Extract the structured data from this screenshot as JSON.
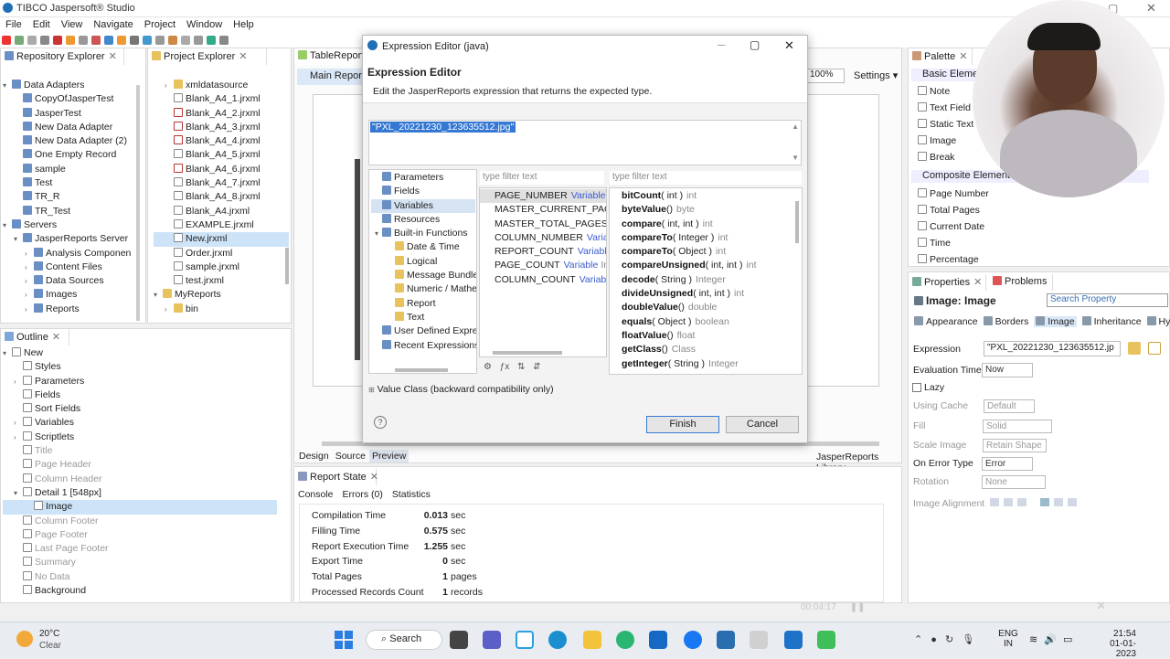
{
  "app": {
    "title": "TIBCO Jaspersoft® Studio"
  },
  "menu": [
    "File",
    "Edit",
    "View",
    "Navigate",
    "Project",
    "Window",
    "Help"
  ],
  "repo": {
    "tab": "Repository Explorer",
    "items": [
      {
        "label": "Data Adapters",
        "level": 0,
        "fold": "v"
      },
      {
        "label": "CopyOfJasperTest",
        "level": 1
      },
      {
        "label": "JasperTest",
        "level": 1
      },
      {
        "label": "New Data Adapter",
        "level": 1
      },
      {
        "label": "New Data Adapter (2)",
        "level": 1
      },
      {
        "label": "One Empty Record",
        "level": 1
      },
      {
        "label": "sample",
        "level": 1
      },
      {
        "label": "Test",
        "level": 1
      },
      {
        "label": "TR_R",
        "level": 1
      },
      {
        "label": "TR_Test",
        "level": 1
      },
      {
        "label": "Servers",
        "level": 0,
        "fold": "v"
      },
      {
        "label": "JasperReports Server",
        "level": 1,
        "fold": "v"
      },
      {
        "label": "Analysis Componen",
        "level": 2,
        "fold": ">"
      },
      {
        "label": "Content Files",
        "level": 2,
        "fold": ">"
      },
      {
        "label": "Data Sources",
        "level": 2,
        "fold": ">"
      },
      {
        "label": "Images",
        "level": 2,
        "fold": ">"
      },
      {
        "label": "Reports",
        "level": 2,
        "fold": ">"
      }
    ]
  },
  "project": {
    "tab": "Project Explorer",
    "items": [
      {
        "label": "xmldatasource",
        "level": 0,
        "fold": ">",
        "type": "folder"
      },
      {
        "label": "Blank_A4_1.jrxml",
        "level": 0,
        "type": "file"
      },
      {
        "label": "Blank_A4_2.jrxml",
        "level": 0,
        "type": "filer"
      },
      {
        "label": "Blank_A4_3.jrxml",
        "level": 0,
        "type": "filer"
      },
      {
        "label": "Blank_A4_4.jrxml",
        "level": 0,
        "type": "filer"
      },
      {
        "label": "Blank_A4_5.jrxml",
        "level": 0,
        "type": "file"
      },
      {
        "label": "Blank_A4_6.jrxml",
        "level": 0,
        "type": "filer"
      },
      {
        "label": "Blank_A4_7.jrxml",
        "level": 0,
        "type": "file"
      },
      {
        "label": "Blank_A4_8.jrxml",
        "level": 0,
        "type": "file"
      },
      {
        "label": "Blank_A4.jrxml",
        "level": 0,
        "type": "file"
      },
      {
        "label": "EXAMPLE.jrxml",
        "level": 0,
        "type": "file"
      },
      {
        "label": "New.jrxml",
        "level": 0,
        "type": "file",
        "selected": true
      },
      {
        "label": "Order.jrxml",
        "level": 0,
        "type": "file"
      },
      {
        "label": "sample.jrxml",
        "level": 0,
        "type": "file"
      },
      {
        "label": "test.jrxml",
        "level": 0,
        "type": "file"
      },
      {
        "label": "MyReports",
        "level": -1,
        "fold": "v",
        "type": "folder"
      },
      {
        "label": "bin",
        "level": 0,
        "fold": ">",
        "type": "folder"
      }
    ]
  },
  "outline": {
    "tab": "Outline",
    "items": [
      {
        "label": "New",
        "level": 0,
        "fold": "v"
      },
      {
        "label": "Styles",
        "level": 1
      },
      {
        "label": "Parameters",
        "level": 1,
        "fold": ">"
      },
      {
        "label": "Fields",
        "level": 1
      },
      {
        "label": "Sort Fields",
        "level": 1
      },
      {
        "label": "Variables",
        "level": 1,
        "fold": ">"
      },
      {
        "label": "Scriptlets",
        "level": 1,
        "fold": ">"
      },
      {
        "label": "Title",
        "level": 1,
        "dim": true
      },
      {
        "label": "Page Header",
        "level": 1,
        "dim": true
      },
      {
        "label": "Column Header",
        "level": 1,
        "dim": true
      },
      {
        "label": "Detail 1 [548px]",
        "level": 1,
        "fold": "v"
      },
      {
        "label": "Image",
        "level": 2,
        "selected": true
      },
      {
        "label": "Column Footer",
        "level": 1,
        "dim": true
      },
      {
        "label": "Page Footer",
        "level": 1,
        "dim": true
      },
      {
        "label": "Last Page Footer",
        "level": 1,
        "dim": true
      },
      {
        "label": "Summary",
        "level": 1,
        "dim": true
      },
      {
        "label": "No Data",
        "level": 1,
        "dim": true
      },
      {
        "label": "Background",
        "level": 1
      }
    ]
  },
  "editor": {
    "tab": "TableReport",
    "subtab": "Main Report",
    "zoom": "100%",
    "settings": "Settings",
    "bottom_tabs": [
      "Design",
      "Source",
      "Preview"
    ],
    "lib": "JasperReports Library"
  },
  "dialog": {
    "window_title": "Expression Editor (java)",
    "heading": "Expression Editor",
    "description": "Edit the JasperReports expression that returns the expected type.",
    "expression": "\"PXL_20221230_123635512.jpg\"",
    "categories": [
      {
        "label": "Parameters",
        "level": 0
      },
      {
        "label": "Fields",
        "level": 0
      },
      {
        "label": "Variables",
        "level": 0,
        "selected": true
      },
      {
        "label": "Resources",
        "level": 0
      },
      {
        "label": "Built-in Functions",
        "level": 0,
        "fold": "v"
      },
      {
        "label": "Date & Time",
        "level": 1
      },
      {
        "label": "Logical",
        "level": 1
      },
      {
        "label": "Message Bundles",
        "level": 1
      },
      {
        "label": "Numeric / Mathe",
        "level": 1
      },
      {
        "label": "Report",
        "level": 1
      },
      {
        "label": "Text",
        "level": 1
      },
      {
        "label": "User Defined Expres",
        "level": 0
      },
      {
        "label": "Recent Expressions",
        "level": 0
      }
    ],
    "filter1": "type filter text",
    "filter2": "type filter text",
    "variables": [
      {
        "name": "PAGE_NUMBER",
        "kind": "Variable",
        "type": "Inte",
        "selected": true
      },
      {
        "name": "MASTER_CURRENT_PAGE",
        "kind": "Va",
        "type": ""
      },
      {
        "name": "MASTER_TOTAL_PAGES",
        "kind": "Varia",
        "type": ""
      },
      {
        "name": "COLUMN_NUMBER",
        "kind": "Variable",
        "type": ""
      },
      {
        "name": "REPORT_COUNT",
        "kind": "Variable",
        "type": "Int"
      },
      {
        "name": "PAGE_COUNT",
        "kind": "Variable",
        "type": "Integ"
      },
      {
        "name": "COLUMN_COUNT",
        "kind": "Variable",
        "type": "I"
      }
    ],
    "methods": [
      {
        "name": "bitCount",
        "args": "( int )",
        "ret": "int"
      },
      {
        "name": "byteValue",
        "args": "()",
        "ret": "byte"
      },
      {
        "name": "compare",
        "args": "( int, int )",
        "ret": "int"
      },
      {
        "name": "compareTo",
        "args": "( Integer )",
        "ret": "int"
      },
      {
        "name": "compareTo",
        "args": "( Object )",
        "ret": "int"
      },
      {
        "name": "compareUnsigned",
        "args": "( int, int )",
        "ret": "int"
      },
      {
        "name": "decode",
        "args": "( String )",
        "ret": "Integer"
      },
      {
        "name": "divideUnsigned",
        "args": "( int, int )",
        "ret": "int"
      },
      {
        "name": "doubleValue",
        "args": "()",
        "ret": "double"
      },
      {
        "name": "equals",
        "args": "( Object )",
        "ret": "boolean"
      },
      {
        "name": "floatValue",
        "args": "()",
        "ret": "float"
      },
      {
        "name": "getClass",
        "args": "()",
        "ret": "Class"
      },
      {
        "name": "getInteger",
        "args": "( String )",
        "ret": "Integer"
      }
    ],
    "value_class": "Value Class (backward compatibility only)",
    "finish": "Finish",
    "cancel": "Cancel"
  },
  "palette": {
    "tab": "Palette",
    "group1": "Basic Element",
    "items1": [
      "Note",
      "Text Field",
      "Static Text",
      "Image",
      "Break"
    ],
    "group2": "Composite Elements",
    "items2": [
      "Page Number",
      "Total Pages",
      "Current Date",
      "Time",
      "Percentage"
    ]
  },
  "properties": {
    "tab1": "Properties",
    "tab2": "Problems",
    "title": "Image: Image",
    "search": "Search Property",
    "subtabs": [
      "Appearance",
      "Borders",
      "Image",
      "Inheritance",
      "Hyp"
    ],
    "expression_label": "Expression",
    "expression_value": "\"PXL_20221230_123635512.jp",
    "eval_label": "Evaluation Time",
    "eval_value": "Now",
    "lazy_label": "Lazy",
    "cache_label": "Using Cache",
    "cache_value": "Default",
    "fill_label": "Fill",
    "fill_value": "Solid",
    "scale_label": "Scale Image",
    "scale_value": "Retain Shape",
    "error_label": "On Error Type",
    "error_value": "Error",
    "rotation_label": "Rotation",
    "rotation_value": "None",
    "align_label": "Image Alignment"
  },
  "report_state": {
    "tab": "Report State",
    "subtabs": [
      "Console",
      "Errors (0)",
      "Statistics"
    ],
    "rows": [
      {
        "label": "Compilation Time",
        "value": "0.013",
        "unit": "sec"
      },
      {
        "label": "Filling Time",
        "value": "0.575",
        "unit": "sec"
      },
      {
        "label": "Report Execution Time",
        "value": "1.255",
        "unit": "sec"
      },
      {
        "label": "Export Time",
        "value": "0",
        "unit": "sec"
      },
      {
        "label": "Total Pages",
        "value": "1",
        "unit": "pages"
      },
      {
        "label": "Processed Records Count",
        "value": "1",
        "unit": "records"
      }
    ]
  },
  "recorder": {
    "time": "00:04:17"
  },
  "taskbar": {
    "weather_temp": "20°C",
    "weather_desc": "Clear",
    "search": "Search",
    "lang1": "ENG",
    "lang2": "IN",
    "time": "21:54",
    "date": "01-01-2023"
  }
}
